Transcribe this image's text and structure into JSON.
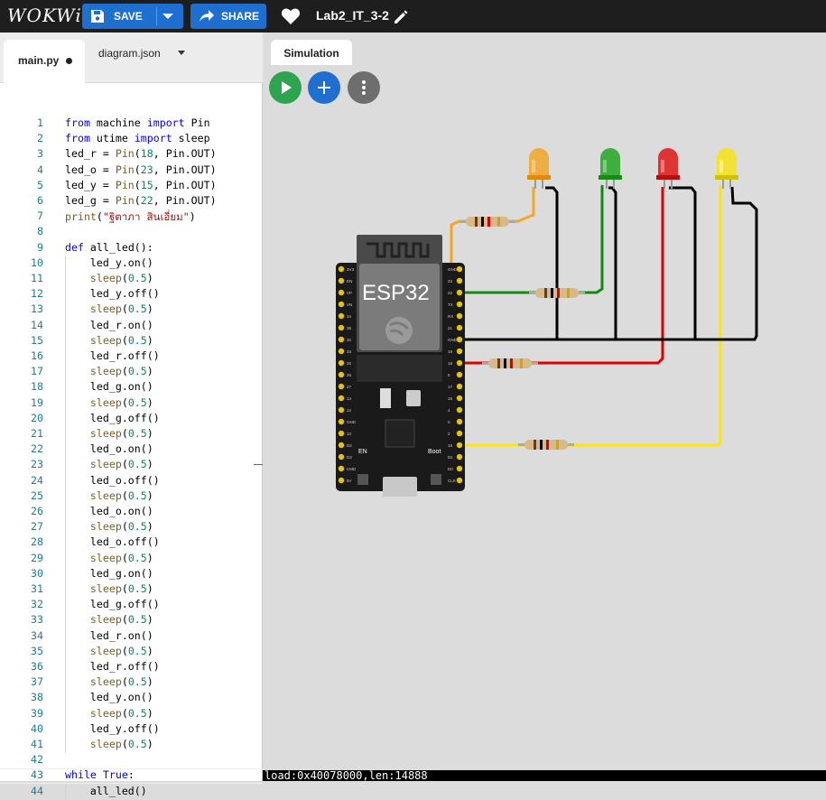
{
  "header": {
    "logo": "WOKWi",
    "save_label": "SAVE",
    "share_label": "SHARE",
    "project_name": "Lab2_IT_3-2",
    "accent": "#1e6fd0"
  },
  "editor": {
    "tabs": [
      {
        "label": "main.py",
        "modified": true
      },
      {
        "label": "diagram.json"
      }
    ],
    "lines": [
      "from machine import Pin",
      "from utime import sleep",
      "led_r = Pin(18, Pin.OUT)",
      "led_o = Pin(23, Pin.OUT)",
      "led_y = Pin(15, Pin.OUT)",
      "led_g = Pin(22, Pin.OUT)",
      "print(\"ฐิตาภา สินเอี่ยม\")",
      "",
      "def all_led():",
      "    led_y.on()",
      "    sleep(0.5)",
      "    led_y.off()",
      "    sleep(0.5)",
      "    led_r.on()",
      "    sleep(0.5)",
      "    led_r.off()",
      "    sleep(0.5)",
      "    led_g.on()",
      "    sleep(0.5)",
      "    led_g.off()",
      "    sleep(0.5)",
      "    led_o.on()",
      "    sleep(0.5)",
      "    led_o.off()",
      "    sleep(0.5)",
      "    led_o.on()",
      "    sleep(0.5)",
      "    led_o.off()",
      "    sleep(0.5)",
      "    led_g.on()",
      "    sleep(0.5)",
      "    led_g.off()",
      "    sleep(0.5)",
      "    led_r.on()",
      "    sleep(0.5)",
      "    led_r.off()",
      "    sleep(0.5)",
      "    led_y.on()",
      "    sleep(0.5)",
      "    led_y.off()",
      "    sleep(0.5)",
      "",
      "while True:",
      "    all_led()"
    ]
  },
  "simulation": {
    "tab_label": "Simulation",
    "board_label": "ESP32",
    "en_label": "EN",
    "boot_label": "Boot",
    "left_pins": [
      "3V3",
      "EN",
      "VP",
      "VN",
      "34",
      "35",
      "32",
      "33",
      "25",
      "26",
      "27",
      "14",
      "12",
      "GND",
      "13",
      "D2",
      "D3",
      "CMD",
      "5V"
    ],
    "right_pins": [
      "GND",
      "23",
      "22",
      "TX",
      "RX",
      "21",
      "GND",
      "19",
      "18",
      "5",
      "17",
      "16",
      "4",
      "0",
      "2",
      "15",
      "D1",
      "D0",
      "CLK"
    ],
    "leds": [
      {
        "name": "orange",
        "color": "#f0a830"
      },
      {
        "name": "green",
        "color": "#2ea82e"
      },
      {
        "name": "red",
        "color": "#e02020"
      },
      {
        "name": "yellow",
        "color": "#f2e227"
      }
    ],
    "wire_colors": {
      "orange": "#f5a623",
      "green": "#138a13",
      "red": "#e00000",
      "yellow": "#ffe600",
      "gnd": "#000000"
    }
  },
  "serial": {
    "text": "load:0x40078000,len:14888"
  }
}
